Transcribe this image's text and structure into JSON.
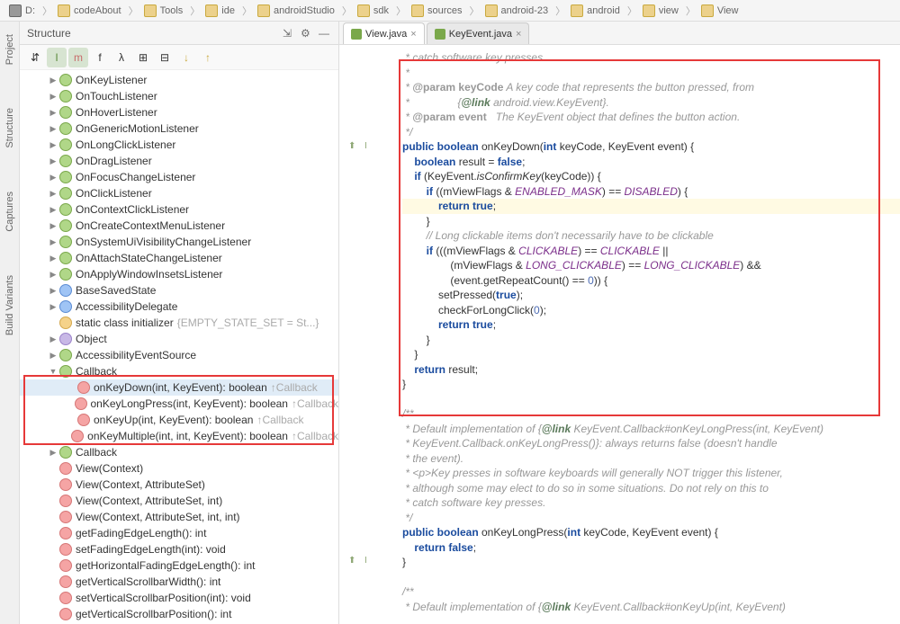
{
  "breadcrumb": [
    "D:",
    "codeAbout",
    "Tools",
    "ide",
    "androidStudio",
    "sdk",
    "sources",
    "android-23",
    "android",
    "view",
    "View"
  ],
  "structure": {
    "title": "Structure",
    "items": [
      {
        "type": "interface",
        "label": "OnKeyListener",
        "arrow": "▶"
      },
      {
        "type": "interface",
        "label": "OnTouchListener",
        "arrow": "▶"
      },
      {
        "type": "interface",
        "label": "OnHoverListener",
        "arrow": "▶"
      },
      {
        "type": "interface",
        "label": "OnGenericMotionListener",
        "arrow": "▶"
      },
      {
        "type": "interface",
        "label": "OnLongClickListener",
        "arrow": "▶"
      },
      {
        "type": "interface",
        "label": "OnDragListener",
        "arrow": "▶"
      },
      {
        "type": "interface",
        "label": "OnFocusChangeListener",
        "arrow": "▶"
      },
      {
        "type": "interface",
        "label": "OnClickListener",
        "arrow": "▶"
      },
      {
        "type": "interface",
        "label": "OnContextClickListener",
        "arrow": "▶"
      },
      {
        "type": "interface",
        "label": "OnCreateContextMenuListener",
        "arrow": "▶"
      },
      {
        "type": "interface",
        "label": "OnSystemUiVisibilityChangeListener",
        "arrow": "▶"
      },
      {
        "type": "interface",
        "label": "OnAttachStateChangeListener",
        "arrow": "▶"
      },
      {
        "type": "interface",
        "label": "OnApplyWindowInsetsListener",
        "arrow": "▶"
      },
      {
        "type": "class",
        "label": "BaseSavedState",
        "arrow": "▶"
      },
      {
        "type": "class",
        "label": "AccessibilityDelegate",
        "arrow": "▶"
      },
      {
        "type": "init",
        "label": "static class initializer",
        "hint": "{EMPTY_STATE_SET = St...}",
        "arrow": ""
      },
      {
        "type": "obj",
        "label": "Object",
        "arrow": "▶"
      },
      {
        "type": "interface",
        "label": "AccessibilityEventSource",
        "arrow": "▶"
      },
      {
        "type": "interface",
        "label": "Callback",
        "arrow": "▼",
        "expanded": true
      },
      {
        "type": "method",
        "label": "onKeyDown(int, KeyEvent): boolean",
        "hint": "↑Callback",
        "indent": true,
        "selected": true
      },
      {
        "type": "method",
        "label": "onKeyLongPress(int, KeyEvent): boolean",
        "hint": "↑Callback",
        "indent": true
      },
      {
        "type": "method",
        "label": "onKeyUp(int, KeyEvent): boolean",
        "hint": "↑Callback",
        "indent": true
      },
      {
        "type": "method",
        "label": "onKeyMultiple(int, int, KeyEvent): boolean",
        "hint": "↑Callback",
        "indent": true
      },
      {
        "type": "interface",
        "label": "Callback",
        "arrow": "▶"
      },
      {
        "type": "method",
        "label": "View(Context)",
        "arrow": ""
      },
      {
        "type": "method",
        "label": "View(Context, AttributeSet)",
        "arrow": ""
      },
      {
        "type": "method",
        "label": "View(Context, AttributeSet, int)",
        "arrow": ""
      },
      {
        "type": "method",
        "label": "View(Context, AttributeSet, int, int)",
        "arrow": ""
      },
      {
        "type": "method",
        "label": "getFadingEdgeLength(): int",
        "arrow": ""
      },
      {
        "type": "method",
        "label": "setFadingEdgeLength(int): void",
        "arrow": ""
      },
      {
        "type": "method",
        "label": "getHorizontalFadingEdgeLength(): int",
        "arrow": ""
      },
      {
        "type": "method",
        "label": "getVerticalScrollbarWidth(): int",
        "arrow": ""
      },
      {
        "type": "method",
        "label": "setVerticalScrollbarPosition(int): void",
        "arrow": ""
      },
      {
        "type": "method",
        "label": "getVerticalScrollbarPosition(): int",
        "arrow": ""
      }
    ]
  },
  "tabs": [
    {
      "label": "View.java",
      "active": true
    },
    {
      "label": "KeyEvent.java",
      "active": false
    }
  ],
  "sidebarTabs": [
    "Project",
    "Structure",
    "Captures",
    "Build Variants"
  ],
  "code": {
    "lines": [
      {
        "t": "cmnt",
        "s": " * catch software key presses."
      },
      {
        "t": "cmnt",
        "s": " *"
      },
      {
        "t": "param",
        "name": "keyCode",
        "desc": "A key code that represents the button pressed, from"
      },
      {
        "t": "cmnt-link",
        "pre": " *                {",
        "link": "@link",
        "post": " android.view.KeyEvent}."
      },
      {
        "t": "param",
        "name": "event",
        "desc": "  The KeyEvent object that defines the button action."
      },
      {
        "t": "cmnt",
        "s": " */"
      },
      {
        "t": "sig1",
        "kw1": "public boolean",
        "fn": "onKeyDown",
        "p": "(",
        "kw2": "int",
        "r": " keyCode, KeyEvent event) {"
      },
      {
        "t": "line",
        "pre": "    ",
        "kw": "boolean",
        "r": " result = ",
        "kw3": "false",
        "end": ";"
      },
      {
        "t": "blank"
      },
      {
        "t": "line",
        "pre": "    ",
        "kw": "if",
        "r": " (KeyEvent.",
        "i": "isConfirmKey",
        "r2": "(keyCode)) {"
      },
      {
        "t": "line",
        "pre": "        ",
        "kw": "if",
        "r": " ((mViewFlags & ",
        "pp": "ENABLED_MASK",
        "r2": ") == ",
        "pp2": "DISABLED",
        "r3": ") {"
      },
      {
        "t": "ret",
        "pre": "            ",
        "kw": "return true",
        "end": ";",
        "hl": true
      },
      {
        "t": "plain",
        "s": "        }"
      },
      {
        "t": "cmnt2",
        "s": "        // Long clickable items don't necessarily have to be clickable"
      },
      {
        "t": "line",
        "pre": "        ",
        "kw": "if",
        "r": " (((mViewFlags & ",
        "pp": "CLICKABLE",
        "r2": ") == ",
        "pp2": "CLICKABLE",
        "r3": " ||"
      },
      {
        "t": "line2",
        "pre": "                (mViewFlags & ",
        "pp": "LONG_CLICKABLE",
        "r": ") == ",
        "pp2": "LONG_CLICKABLE",
        "r2": ") &&"
      },
      {
        "t": "line",
        "pre": "                (event.getRepeatCount() == ",
        "num": "0",
        "r": ")) {"
      },
      {
        "t": "line",
        "pre": "            setPressed(",
        "kw": "true",
        "r": ");"
      },
      {
        "t": "line",
        "pre": "            checkForLongClick(",
        "num": "0",
        "r": ");"
      },
      {
        "t": "ret",
        "pre": "            ",
        "kw": "return true",
        "end": ";"
      },
      {
        "t": "plain",
        "s": "        }"
      },
      {
        "t": "plain",
        "s": "    }"
      },
      {
        "t": "blank"
      },
      {
        "t": "ret2",
        "pre": "    ",
        "kw": "return",
        "r": " result;"
      },
      {
        "t": "plain",
        "s": "}"
      },
      {
        "t": "blank"
      },
      {
        "t": "cmnt",
        "s": "/**"
      },
      {
        "t": "cmnt-link2",
        "pre": " * Default implementation of {",
        "link": "@link",
        "post": " KeyEvent.Callback#onKeyLongPress(int, KeyEvent)"
      },
      {
        "t": "cmnt",
        "s": " * KeyEvent.Callback.onKeyLongPress()}: always returns false (doesn't handle"
      },
      {
        "t": "cmnt",
        "s": " * the event)."
      },
      {
        "t": "cmnt",
        "s": " * <p>Key presses in software keyboards will generally NOT trigger this listener,"
      },
      {
        "t": "cmnt",
        "s": " * although some may elect to do so in some situations. Do not rely on this to"
      },
      {
        "t": "cmnt",
        "s": " * catch software key presses."
      },
      {
        "t": "cmnt",
        "s": " */"
      },
      {
        "t": "sig1",
        "kw1": "public boolean",
        "fn": "onKeyLongPress",
        "p": "(",
        "kw2": "int",
        "r": " keyCode, KeyEvent event) {"
      },
      {
        "t": "ret",
        "pre": "    ",
        "kw": "return false",
        "end": ";"
      },
      {
        "t": "plain",
        "s": "}"
      },
      {
        "t": "blank"
      },
      {
        "t": "cmnt",
        "s": "/**"
      },
      {
        "t": "cmnt-link2",
        "pre": " * Default implementation of {",
        "link": "@link",
        "post": " KeyEvent.Callback#onKeyUp(int, KeyEvent)"
      }
    ]
  }
}
